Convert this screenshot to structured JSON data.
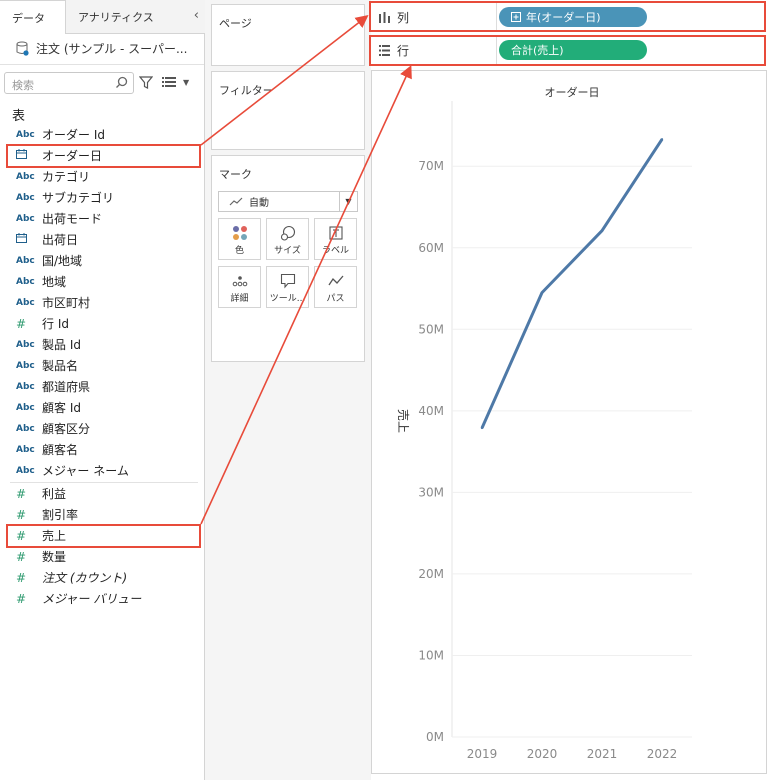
{
  "tabs": {
    "data": "データ",
    "analytics": "アナリティクス"
  },
  "datasource": "注文 (サンプル - スーパー...",
  "search": {
    "placeholder": "検索"
  },
  "table_label": "表",
  "dimensions": [
    {
      "icon": "Abc",
      "name": "オーダー Id"
    },
    {
      "icon": "date",
      "name": "オーダー日"
    },
    {
      "icon": "Abc",
      "name": "カテゴリ"
    },
    {
      "icon": "Abc",
      "name": "サブカテゴリ"
    },
    {
      "icon": "Abc",
      "name": "出荷モード"
    },
    {
      "icon": "date",
      "name": "出荷日"
    },
    {
      "icon": "Abc",
      "name": "国/地域"
    },
    {
      "icon": "Abc",
      "name": "地域"
    },
    {
      "icon": "Abc",
      "name": "市区町村"
    },
    {
      "icon": "#",
      "name": "行 Id"
    },
    {
      "icon": "Abc",
      "name": "製品 Id"
    },
    {
      "icon": "Abc",
      "name": "製品名"
    },
    {
      "icon": "Abc",
      "name": "都道府県"
    },
    {
      "icon": "Abc",
      "name": "顧客 Id"
    },
    {
      "icon": "Abc",
      "name": "顧客区分"
    },
    {
      "icon": "Abc",
      "name": "顧客名"
    },
    {
      "icon": "Abc",
      "name": "メジャー ネーム"
    }
  ],
  "measures": [
    {
      "icon": "#",
      "name": "利益"
    },
    {
      "icon": "#",
      "name": "割引率"
    },
    {
      "icon": "#",
      "name": "売上"
    },
    {
      "icon": "#",
      "name": "数量"
    },
    {
      "icon": "#",
      "name": "注文 (カウント)"
    },
    {
      "icon": "#",
      "name": "メジャー バリュー"
    }
  ],
  "cards": {
    "pages": "ページ",
    "filters": "フィルター",
    "marks": "マーク",
    "mark_type": "自動",
    "buttons": [
      "色",
      "サイズ",
      "ラベル",
      "詳細",
      "ツール...",
      "パス"
    ]
  },
  "shelves": {
    "columns_label": "列",
    "columns_pill": "年(オーダー日)",
    "rows_label": "行",
    "rows_pill": "合計(売上)"
  },
  "colors": {
    "accent_red": "#e84b3a",
    "pill_blue": "#4a94b8",
    "pill_green": "#22ad79",
    "line": "#4e79a7"
  },
  "chart_data": {
    "type": "line",
    "title": "オーダー日",
    "ylabel": "売上",
    "categories": [
      "2019",
      "2020",
      "2021",
      "2022"
    ],
    "values": [
      37.9,
      54.5,
      62.1,
      73.3
    ],
    "ylim": [
      0,
      78
    ],
    "yticks": [
      "0M",
      "10M",
      "20M",
      "30M",
      "40M",
      "50M",
      "60M",
      "70M"
    ],
    "grid": true
  }
}
